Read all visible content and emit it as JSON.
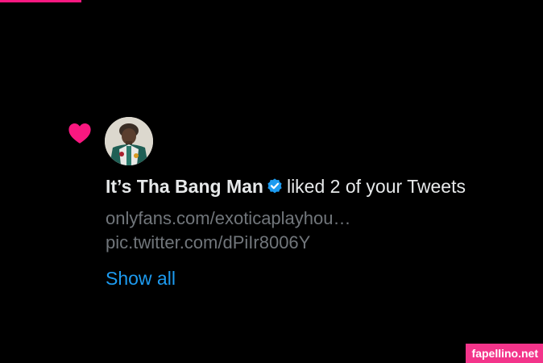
{
  "colors": {
    "background": "#000000",
    "text": "#e7e9ea",
    "secondary_text": "#71767b",
    "link": "#1d9bf0",
    "heart": "#f91880",
    "verified": "#1d9bf0"
  },
  "notification": {
    "icon": "heart-icon",
    "avatar": "user-avatar",
    "user_name": "It’s Tha Bang Man",
    "verified_icon": "verified-badge-icon",
    "action_text": "liked 2 of your Tweets",
    "tweet_lines": [
      "onlyfans.com/exoticaplayhou…",
      "pic.twitter.com/dPiIr8006Y"
    ],
    "show_all_label": "Show all"
  },
  "watermark": {
    "text": "fapellino.net"
  }
}
